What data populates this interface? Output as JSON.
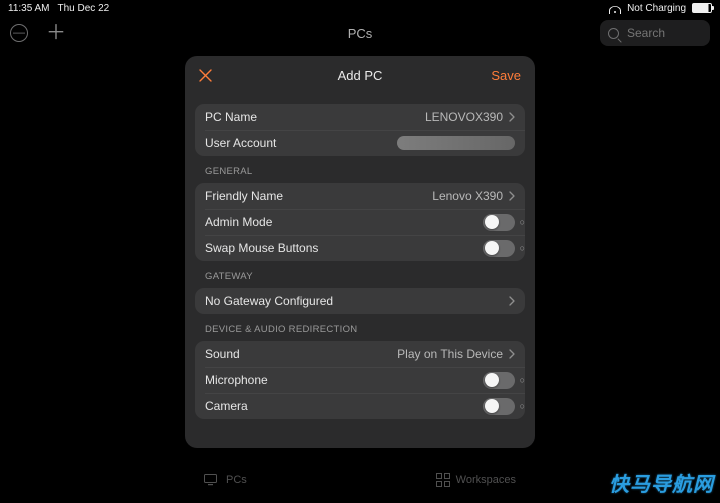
{
  "status": {
    "time": "11:35 AM",
    "date": "Thu Dec 22",
    "charging_label": "Not Charging"
  },
  "toolbar": {
    "title": "PCs",
    "search_placeholder": "Search"
  },
  "modal": {
    "title": "Add PC",
    "close_label": "Close",
    "save_label": "Save",
    "basic": {
      "pc_name_label": "PC Name",
      "pc_name_value": "LENOVOX390",
      "user_account_label": "User Account"
    },
    "sections": {
      "general_header": "GENERAL",
      "friendly_name_label": "Friendly Name",
      "friendly_name_value": "Lenovo X390",
      "admin_mode_label": "Admin Mode",
      "admin_mode_on": false,
      "swap_mouse_label": "Swap Mouse Buttons",
      "swap_mouse_on": false,
      "gateway_header": "GATEWAY",
      "gateway_value": "No Gateway Configured",
      "redir_header": "DEVICE & AUDIO REDIRECTION",
      "sound_label": "Sound",
      "sound_value": "Play on This Device",
      "microphone_label": "Microphone",
      "microphone_on": false,
      "camera_label": "Camera",
      "camera_on": false
    }
  },
  "tabs": {
    "pcs_label": "PCs",
    "workspaces_label": "Workspaces"
  },
  "watermark": "快马导航网"
}
